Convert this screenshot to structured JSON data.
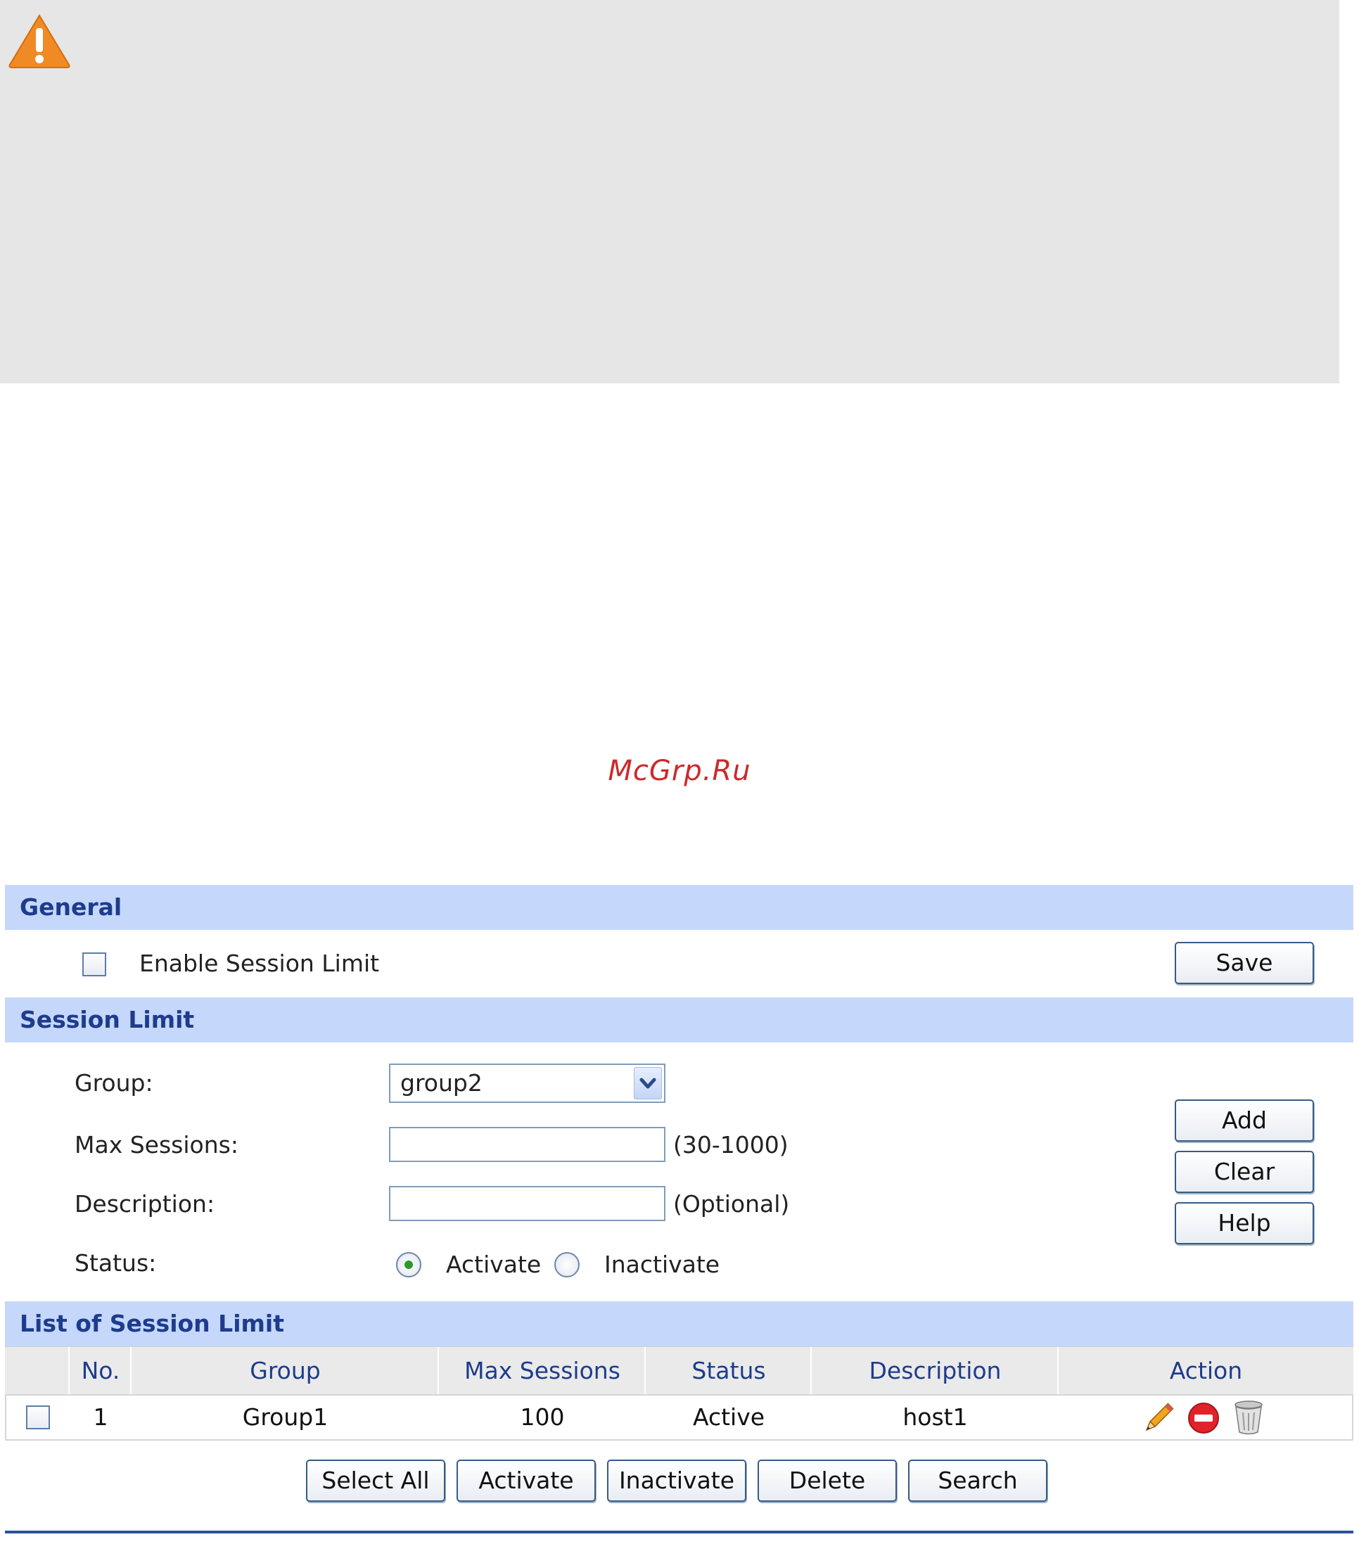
{
  "watermark": "McGrp.Ru",
  "general": {
    "title": "General",
    "enable_label": "Enable Session Limit",
    "save_label": "Save"
  },
  "session_limit": {
    "title": "Session Limit",
    "group_label": "Group:",
    "group_value": "group2",
    "max_sessions_label": "Max Sessions:",
    "max_sessions_value": "",
    "max_sessions_hint": "(30-1000)",
    "description_label": "Description:",
    "description_value": "",
    "description_hint": "(Optional)",
    "status_label": "Status:",
    "status_activate": "Activate",
    "status_inactivate": "Inactivate",
    "status_selected": "Activate",
    "add_label": "Add",
    "clear_label": "Clear",
    "help_label": "Help"
  },
  "list": {
    "title": "List of Session Limit",
    "columns": [
      "No.",
      "Group",
      "Max Sessions",
      "Status",
      "Description",
      "Action"
    ],
    "rows": [
      {
        "no": "1",
        "group": "Group1",
        "max_sessions": "100",
        "status": "Active",
        "description": "host1"
      }
    ],
    "buttons": {
      "select_all": "Select All",
      "activate": "Activate",
      "inactivate": "Inactivate",
      "delete": "Delete",
      "search": "Search"
    }
  },
  "icons": {
    "warning": "warning-icon",
    "edit": "pencil-icon",
    "disable": "stop-icon",
    "delete": "trash-icon"
  },
  "colors": {
    "section_header_bg": "#c5d7fb",
    "section_header_text": "#1e3c8c",
    "watermark": "#cc2a2a",
    "warning_orange": "#f08a24"
  }
}
